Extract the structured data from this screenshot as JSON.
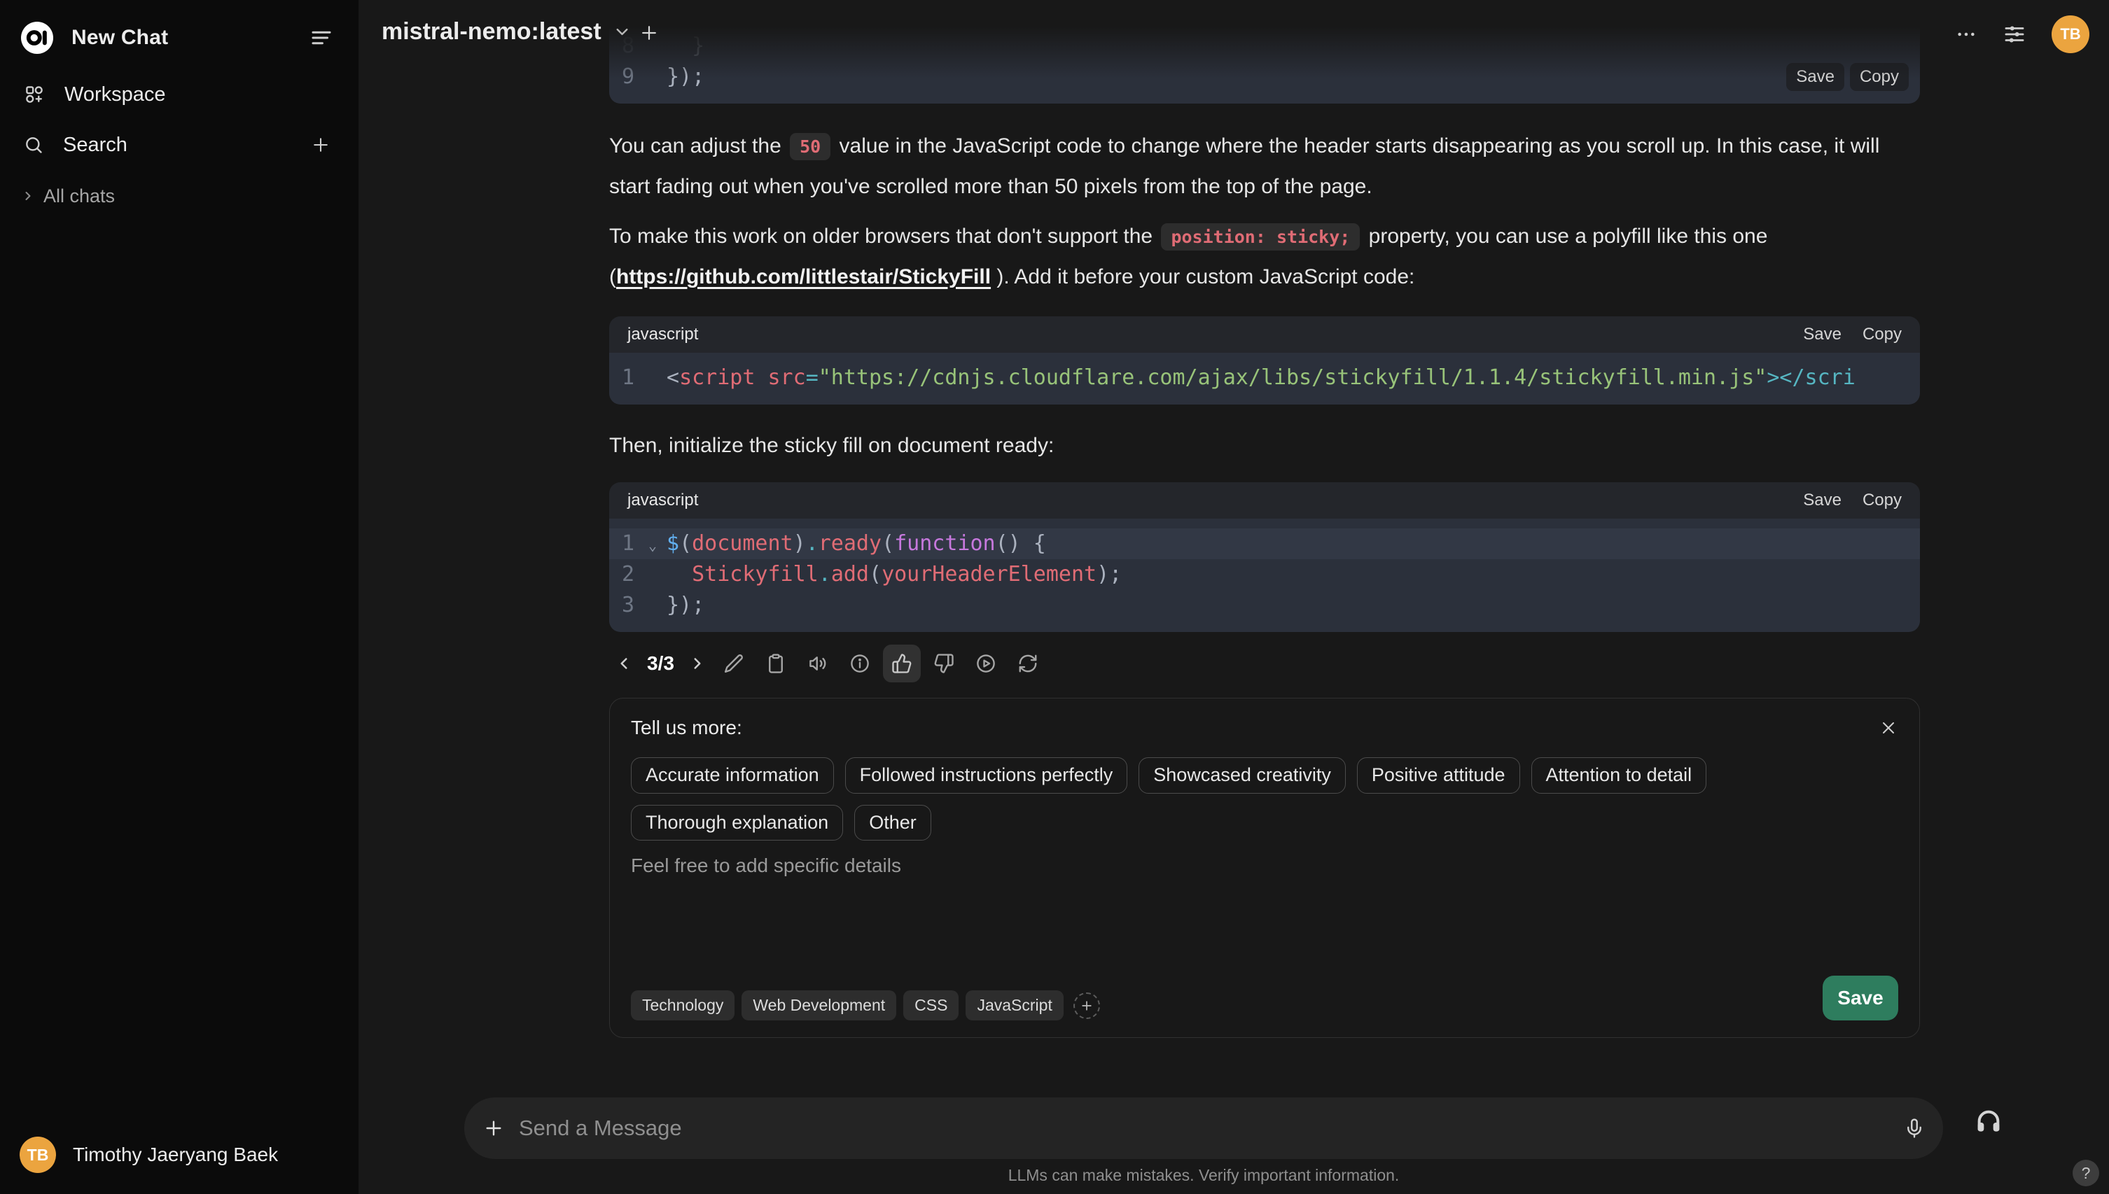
{
  "colors": {
    "sidebar_bg": "#0b0b0b",
    "main_bg": "#181818",
    "code_bg": "#2b303b",
    "save_button_green": "#2e7d5e",
    "avatar_orange": "#eba43f",
    "inline_code_red": "#e06c75"
  },
  "sidebar": {
    "new_chat": "New Chat",
    "workspace": "Workspace",
    "search": "Search",
    "all_chats": "All chats",
    "user_initials": "TB",
    "user_name": "Timothy Jaeryang Baek"
  },
  "header": {
    "model": "mistral-nemo:latest",
    "profile_initials": "TB"
  },
  "message": {
    "p1_before": "You can adjust the ",
    "p1_code": "50",
    "p1_after": " value in the JavaScript code to change where the header starts disappearing as you scroll up. In this case, it will start fading out when you've scrolled more than 50 pixels from the top of the page.",
    "p2_before": "To make this work on older browsers that don't support the ",
    "p2_code": "position: sticky;",
    "p2_mid": " property, you can use a polyfill like this one (",
    "p2_link": "https://github.com/littlestair/StickyFill",
    "p2_after": " ). Add it before your custom JavaScript code:",
    "p3": "Then, initialize the sticky fill on document ready:"
  },
  "code_blocks": {
    "partial": {
      "save": "Save",
      "copy": "Copy",
      "lines": [
        {
          "num": "8",
          "faded": true,
          "tokens": [
            [
              "pun",
              "  }"
            ]
          ]
        },
        {
          "num": "9",
          "tokens": [
            [
              "pun",
              "});"
            ]
          ]
        }
      ]
    },
    "polyfill": {
      "language": "javascript",
      "save": "Save",
      "copy": "Copy",
      "lines": [
        {
          "num": "1",
          "tokens": [
            [
              "pun",
              "<"
            ],
            [
              "tag",
              "script"
            ],
            [
              "attr",
              " src"
            ],
            [
              "op",
              "="
            ],
            [
              "str",
              "\"https://cdnjs.cloudflare.com/ajax/libs/stickyfill/1.1.4/stickyfill.min.js\""
            ],
            [
              "op",
              "></scri"
            ]
          ]
        }
      ]
    },
    "init": {
      "language": "javascript",
      "save": "Save",
      "copy": "Copy",
      "lines": [
        {
          "num": "1",
          "fold": true,
          "highlight": true,
          "tokens": [
            [
              "var",
              "$"
            ],
            [
              "pun",
              "("
            ],
            [
              "name",
              "document"
            ],
            [
              "pun",
              ")"
            ],
            [
              "op",
              "."
            ],
            [
              "name",
              "ready"
            ],
            [
              "pun",
              "("
            ],
            [
              "kw",
              "function"
            ],
            [
              "pun",
              "() {"
            ]
          ]
        },
        {
          "num": "2",
          "tokens": [
            [
              "pun",
              "  "
            ],
            [
              "name",
              "Stickyfill"
            ],
            [
              "op",
              "."
            ],
            [
              "name",
              "add"
            ],
            [
              "pun",
              "("
            ],
            [
              "name",
              "yourHeaderElement"
            ],
            [
              "pun",
              ");"
            ]
          ]
        },
        {
          "num": "3",
          "tokens": [
            [
              "pun",
              "});"
            ]
          ]
        }
      ]
    }
  },
  "actions": {
    "counter": "3/3"
  },
  "feedback": {
    "title": "Tell us more:",
    "reasons": [
      "Accurate information",
      "Followed instructions perfectly",
      "Showcased creativity",
      "Positive attitude",
      "Attention to detail",
      "Thorough explanation",
      "Other"
    ],
    "details_placeholder": "Feel free to add specific details",
    "tags": [
      "Technology",
      "Web Development",
      "CSS",
      "JavaScript"
    ],
    "save": "Save"
  },
  "composer": {
    "placeholder": "Send a Message"
  },
  "footer": {
    "disclaimer": "LLMs can make mistakes. Verify important information.",
    "help": "?"
  }
}
